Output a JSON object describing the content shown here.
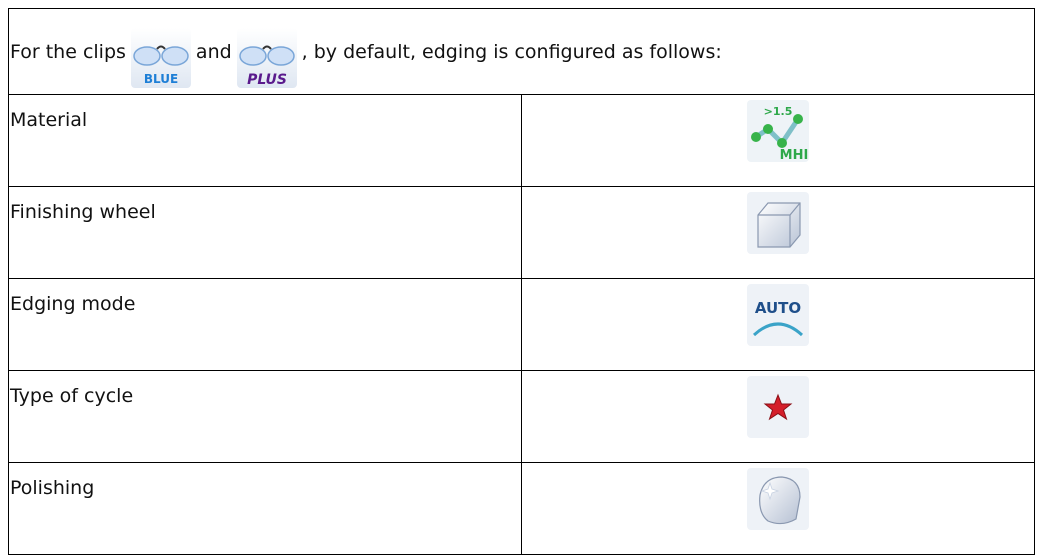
{
  "header": {
    "part1": "For the clips",
    "clip1": {
      "icon": "glasses-blue-icon",
      "label": "BLUE",
      "color": "#1e7fd6"
    },
    "part2": "and",
    "clip2": {
      "icon": "glasses-plus-icon",
      "label": "PLUS",
      "color": "#5a1a8c"
    },
    "part3": ", by default, edging is configured as follows:"
  },
  "rows": [
    {
      "label": "Material",
      "icon": "material-mhi-icon",
      "icon_text": ">1.5",
      "icon_text2": "MHI"
    },
    {
      "label": "Finishing wheel",
      "icon": "finishing-wheel-icon"
    },
    {
      "label": "Edging mode",
      "icon": "edging-mode-auto-icon",
      "icon_text": "AUTO"
    },
    {
      "label": "Type of cycle",
      "icon": "cycle-star-icon"
    },
    {
      "label": "Polishing",
      "icon": "polishing-icon"
    }
  ]
}
